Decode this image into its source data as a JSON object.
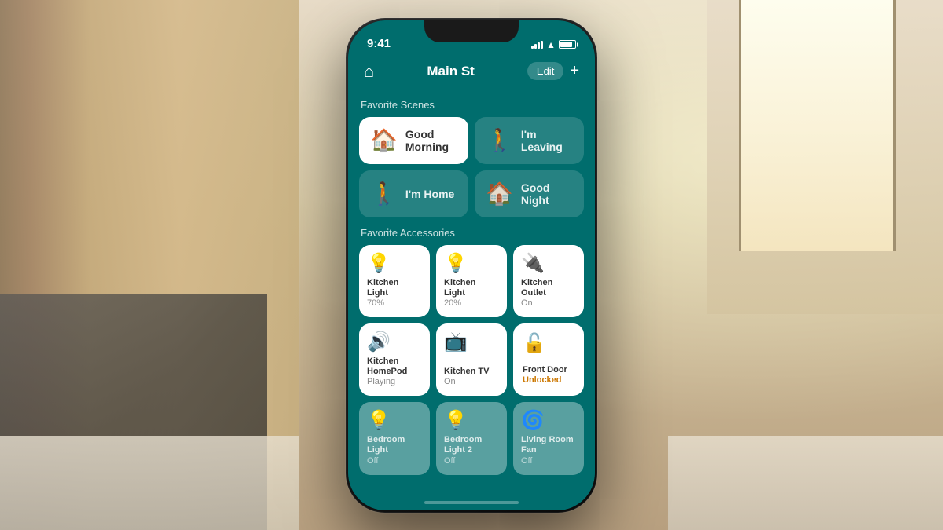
{
  "background": {
    "alt": "Kitchen background"
  },
  "phone": {
    "status_bar": {
      "time": "9:41",
      "signal_label": "signal",
      "wifi_label": "wifi",
      "battery_label": "battery"
    },
    "nav": {
      "home_icon": "⌂",
      "location": "Main St",
      "edit_label": "Edit",
      "add_label": "+"
    },
    "scenes_section": {
      "label": "Favorite Scenes",
      "items": [
        {
          "id": "good-morning",
          "name": "Good Morning",
          "icon": "🏠",
          "active": true
        },
        {
          "id": "im-leaving",
          "name": "I'm Leaving",
          "icon": "🚶",
          "active": false
        },
        {
          "id": "im-home",
          "name": "I'm Home",
          "icon": "🚶",
          "active": false
        },
        {
          "id": "good-night",
          "name": "Good Night",
          "icon": "🏠",
          "active": false
        }
      ]
    },
    "accessories_section": {
      "label": "Favorite Accessories",
      "items": [
        {
          "id": "kitchen-light-1",
          "name": "Kitchen Light",
          "status": "70%",
          "icon": "💡",
          "state": "on"
        },
        {
          "id": "kitchen-light-2",
          "name": "Kitchen Light",
          "status": "20%",
          "icon": "💡",
          "state": "on"
        },
        {
          "id": "kitchen-outlet",
          "name": "Kitchen Outlet",
          "status": "On",
          "icon": "🔌",
          "state": "on"
        },
        {
          "id": "kitchen-homepod",
          "name": "Kitchen HomePod",
          "status": "Playing",
          "icon": "🔊",
          "state": "on"
        },
        {
          "id": "kitchen-tv",
          "name": "Kitchen TV",
          "status": "On",
          "icon": "📺",
          "state": "on"
        },
        {
          "id": "front-door",
          "name": "Front Door",
          "status": "Unlocked",
          "icon": "🔓",
          "state": "unlocked"
        },
        {
          "id": "bedroom-light",
          "name": "Bedroom Light",
          "status": "Off",
          "icon": "💡",
          "state": "off"
        },
        {
          "id": "bedroom-light-2",
          "name": "Bedroom Light 2",
          "status": "Off",
          "icon": "💡",
          "state": "off"
        },
        {
          "id": "living-room-fan",
          "name": "Living Room Fan",
          "status": "Off",
          "icon": "🌀",
          "state": "off"
        }
      ]
    }
  }
}
